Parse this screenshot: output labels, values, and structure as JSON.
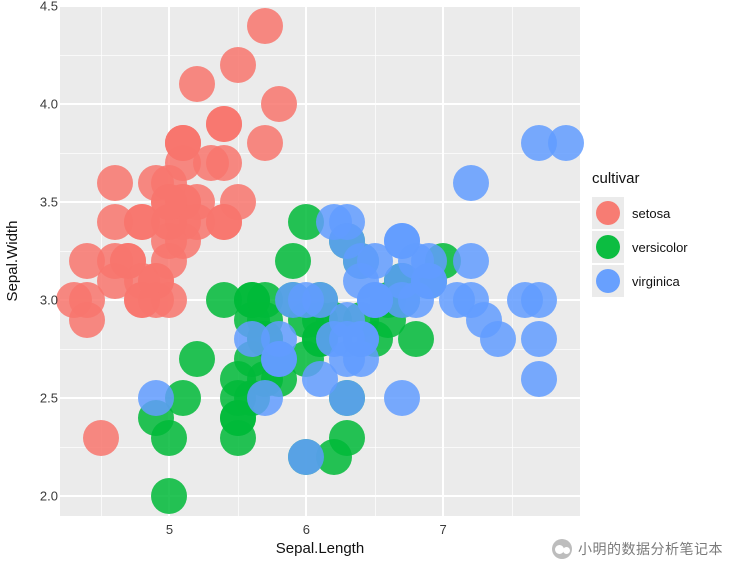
{
  "chart_data": {
    "type": "scatter",
    "xlabel": "Sepal.Length",
    "ylabel": "Sepal.Width",
    "xlim": [
      4.2,
      8.0
    ],
    "ylim": [
      1.9,
      4.5
    ],
    "x_ticks": [
      5,
      6,
      7
    ],
    "y_ticks": [
      2.0,
      2.5,
      3.0,
      3.5,
      4.0,
      4.5
    ],
    "legend_title": "cultivar",
    "point_radius_px": 18,
    "colors": {
      "setosa": "#F8766D",
      "versicolor": "#00BA38",
      "virginica": "#619CFF"
    },
    "series": [
      {
        "name": "setosa",
        "points": [
          [
            5.1,
            3.5
          ],
          [
            4.9,
            3.0
          ],
          [
            4.7,
            3.2
          ],
          [
            4.6,
            3.1
          ],
          [
            5.0,
            3.6
          ],
          [
            5.4,
            3.9
          ],
          [
            4.6,
            3.4
          ],
          [
            5.0,
            3.4
          ],
          [
            4.4,
            2.9
          ],
          [
            4.9,
            3.1
          ],
          [
            5.4,
            3.7
          ],
          [
            4.8,
            3.4
          ],
          [
            4.8,
            3.0
          ],
          [
            4.3,
            3.0
          ],
          [
            5.8,
            4.0
          ],
          [
            5.7,
            4.4
          ],
          [
            5.4,
            3.9
          ],
          [
            5.1,
            3.5
          ],
          [
            5.7,
            3.8
          ],
          [
            5.1,
            3.8
          ],
          [
            5.4,
            3.4
          ],
          [
            5.1,
            3.7
          ],
          [
            4.6,
            3.6
          ],
          [
            5.1,
            3.3
          ],
          [
            4.8,
            3.4
          ],
          [
            5.0,
            3.0
          ],
          [
            5.0,
            3.4
          ],
          [
            5.2,
            3.5
          ],
          [
            5.2,
            3.4
          ],
          [
            4.7,
            3.2
          ],
          [
            4.8,
            3.1
          ],
          [
            5.4,
            3.4
          ],
          [
            5.2,
            4.1
          ],
          [
            5.5,
            4.2
          ],
          [
            4.9,
            3.1
          ],
          [
            5.0,
            3.2
          ],
          [
            5.5,
            3.5
          ],
          [
            4.9,
            3.6
          ],
          [
            4.4,
            3.0
          ],
          [
            5.1,
            3.4
          ],
          [
            5.0,
            3.5
          ],
          [
            4.5,
            2.3
          ],
          [
            4.4,
            3.2
          ],
          [
            5.0,
            3.5
          ],
          [
            5.1,
            3.8
          ],
          [
            4.8,
            3.0
          ],
          [
            5.1,
            3.8
          ],
          [
            4.6,
            3.2
          ],
          [
            5.3,
            3.7
          ],
          [
            5.0,
            3.3
          ]
        ]
      },
      {
        "name": "versicolor",
        "points": [
          [
            7.0,
            3.2
          ],
          [
            6.4,
            3.2
          ],
          [
            6.9,
            3.1
          ],
          [
            5.5,
            2.3
          ],
          [
            6.5,
            2.8
          ],
          [
            5.7,
            2.8
          ],
          [
            6.3,
            3.3
          ],
          [
            4.9,
            2.4
          ],
          [
            6.6,
            2.9
          ],
          [
            5.2,
            2.7
          ],
          [
            5.0,
            2.0
          ],
          [
            5.9,
            3.0
          ],
          [
            6.0,
            2.2
          ],
          [
            6.1,
            2.9
          ],
          [
            5.6,
            2.9
          ],
          [
            6.7,
            3.1
          ],
          [
            5.6,
            3.0
          ],
          [
            5.8,
            2.7
          ],
          [
            6.2,
            2.2
          ],
          [
            5.6,
            2.5
          ],
          [
            5.9,
            3.2
          ],
          [
            6.1,
            2.8
          ],
          [
            6.3,
            2.5
          ],
          [
            6.1,
            2.8
          ],
          [
            6.4,
            2.9
          ],
          [
            6.6,
            3.0
          ],
          [
            6.8,
            2.8
          ],
          [
            6.7,
            3.0
          ],
          [
            6.0,
            2.9
          ],
          [
            5.7,
            2.6
          ],
          [
            5.5,
            2.4
          ],
          [
            5.5,
            2.4
          ],
          [
            5.8,
            2.7
          ],
          [
            6.0,
            2.7
          ],
          [
            5.4,
            3.0
          ],
          [
            6.0,
            3.4
          ],
          [
            6.7,
            3.1
          ],
          [
            6.3,
            2.3
          ],
          [
            5.6,
            3.0
          ],
          [
            5.5,
            2.5
          ],
          [
            5.5,
            2.6
          ],
          [
            6.1,
            3.0
          ],
          [
            5.8,
            2.6
          ],
          [
            5.0,
            2.3
          ],
          [
            5.6,
            2.7
          ],
          [
            5.7,
            3.0
          ],
          [
            5.7,
            2.9
          ],
          [
            6.2,
            2.9
          ],
          [
            5.1,
            2.5
          ],
          [
            5.7,
            2.8
          ]
        ]
      },
      {
        "name": "virginica",
        "points": [
          [
            6.3,
            3.3
          ],
          [
            5.8,
            2.7
          ],
          [
            7.1,
            3.0
          ],
          [
            6.3,
            2.9
          ],
          [
            6.5,
            3.0
          ],
          [
            7.6,
            3.0
          ],
          [
            4.9,
            2.5
          ],
          [
            7.3,
            2.9
          ],
          [
            6.7,
            2.5
          ],
          [
            7.2,
            3.6
          ],
          [
            6.5,
            3.2
          ],
          [
            6.4,
            2.7
          ],
          [
            6.8,
            3.0
          ],
          [
            5.7,
            2.5
          ],
          [
            5.8,
            2.8
          ],
          [
            6.4,
            3.2
          ],
          [
            6.5,
            3.0
          ],
          [
            7.7,
            3.8
          ],
          [
            7.7,
            2.6
          ],
          [
            6.0,
            2.2
          ],
          [
            6.9,
            3.2
          ],
          [
            5.6,
            2.8
          ],
          [
            7.7,
            2.8
          ],
          [
            6.3,
            2.7
          ],
          [
            6.7,
            3.3
          ],
          [
            7.2,
            3.2
          ],
          [
            6.2,
            2.8
          ],
          [
            6.1,
            3.0
          ],
          [
            6.4,
            2.8
          ],
          [
            7.2,
            3.0
          ],
          [
            7.4,
            2.8
          ],
          [
            7.9,
            3.8
          ],
          [
            6.4,
            2.8
          ],
          [
            6.3,
            2.8
          ],
          [
            6.1,
            2.6
          ],
          [
            7.7,
            3.0
          ],
          [
            6.3,
            3.4
          ],
          [
            6.4,
            3.1
          ],
          [
            6.0,
            3.0
          ],
          [
            6.9,
            3.1
          ],
          [
            6.7,
            3.1
          ],
          [
            6.9,
            3.1
          ],
          [
            5.8,
            2.7
          ],
          [
            6.8,
            3.2
          ],
          [
            6.7,
            3.3
          ],
          [
            6.7,
            3.0
          ],
          [
            6.3,
            2.5
          ],
          [
            6.5,
            3.0
          ],
          [
            6.2,
            3.4
          ],
          [
            5.9,
            3.0
          ]
        ]
      }
    ]
  },
  "watermark": "小明的数据分析笔记本"
}
